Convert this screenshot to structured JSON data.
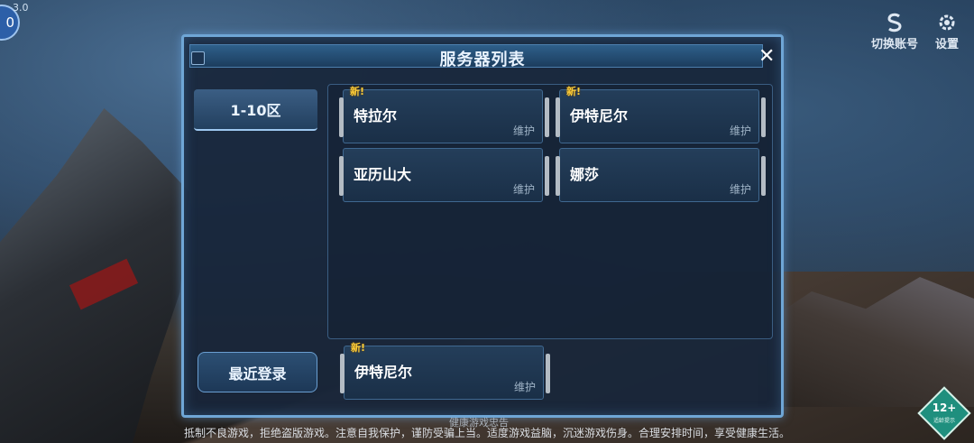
{
  "top_left": {
    "version": "3.0",
    "avatar_text": "0"
  },
  "top_right": {
    "switch_account_label": "切换账号",
    "settings_label": "设置"
  },
  "panel": {
    "title": "服务器列表",
    "close_label": "✕",
    "zone_tab_label": "1-10区",
    "recent_login_label": "最近登录",
    "new_tag": "新!",
    "servers": [
      {
        "name": "特拉尔",
        "status": "维护",
        "is_new": true
      },
      {
        "name": "伊特尼尔",
        "status": "维护",
        "is_new": true
      },
      {
        "name": "亚历山大",
        "status": "维护",
        "is_new": false
      },
      {
        "name": "娜莎",
        "status": "维护",
        "is_new": false
      }
    ],
    "recent_server": {
      "name": "伊特尼尔",
      "status": "维护",
      "is_new": true
    }
  },
  "footer": {
    "notice_title": "健康游戏忠告",
    "notice": "抵制不良游戏，拒绝盗版游戏。注意自我保护，谨防受骗上当。适度游戏益脑，沉迷游戏伤身。合理安排时间，享受健康生活。",
    "age_rating": "12+",
    "age_rating_sub": "适龄提示"
  },
  "colors": {
    "panel_border": "#6fa6d6",
    "new_tag": "#ffcf3a",
    "age_badge": "#1f8f7e"
  }
}
